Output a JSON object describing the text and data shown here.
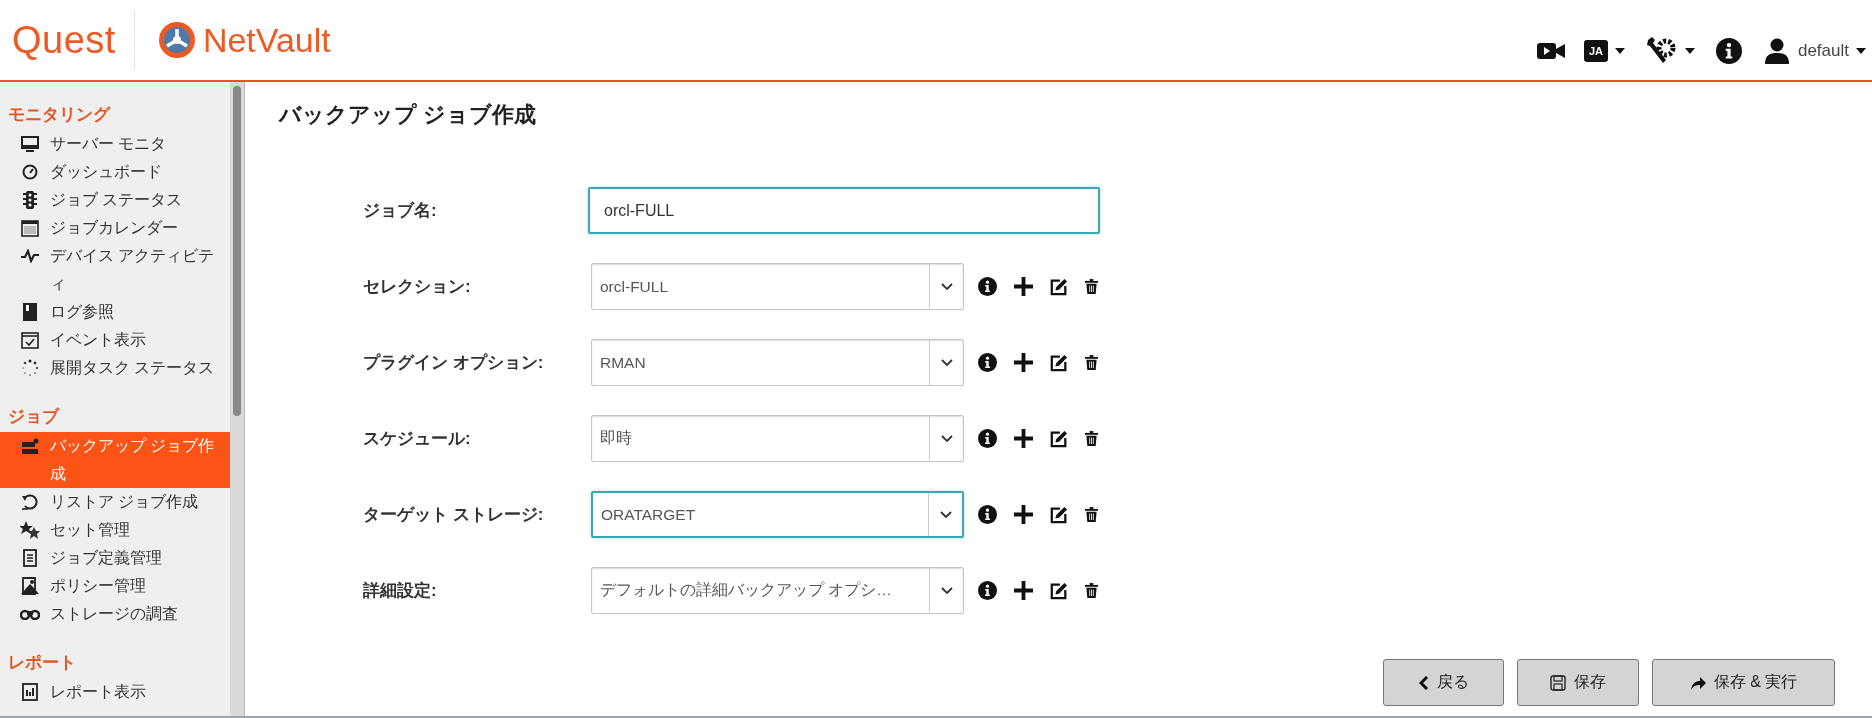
{
  "header": {
    "brand": "Quest",
    "product": "NetVault",
    "language": "JA",
    "user": "default"
  },
  "sidebar": {
    "sections": [
      {
        "title": "モニタリング",
        "items": [
          {
            "label": "サーバー モニタ",
            "selected": false
          },
          {
            "label": "ダッシュボード",
            "selected": false
          },
          {
            "label": "ジョブ ステータス",
            "selected": false
          },
          {
            "label": "ジョブカレンダー",
            "selected": false
          },
          {
            "label": "デバイス アクティビティ",
            "selected": false
          },
          {
            "label": "ログ参照",
            "selected": false
          },
          {
            "label": "イベント表示",
            "selected": false
          },
          {
            "label": "展開タスク ステータス",
            "selected": false
          }
        ]
      },
      {
        "title": "ジョブ",
        "items": [
          {
            "label": "バックアップ ジョブ作成",
            "selected": true
          },
          {
            "label": "リストア ジョブ作成",
            "selected": false
          },
          {
            "label": "セット管理",
            "selected": false
          },
          {
            "label": "ジョブ定義管理",
            "selected": false
          },
          {
            "label": "ポリシー管理",
            "selected": false
          },
          {
            "label": "ストレージの調査",
            "selected": false
          }
        ]
      },
      {
        "title": "レポート",
        "items": [
          {
            "label": "レポート表示",
            "selected": false
          }
        ]
      }
    ]
  },
  "page": {
    "title": "バックアップ ジョブ作成"
  },
  "form": {
    "fields": [
      {
        "kind": "text",
        "label": "ジョブ名:",
        "value": "orcl-FULL",
        "focused": true
      },
      {
        "kind": "select",
        "label": "セレクション:",
        "value": "orcl-FULL",
        "focused": false
      },
      {
        "kind": "select",
        "label": "プラグイン オプション:",
        "value": "RMAN",
        "focused": false
      },
      {
        "kind": "select",
        "label": "スケジュール:",
        "value": "即時",
        "focused": false
      },
      {
        "kind": "select",
        "label": "ターゲット ストレージ:",
        "value": "ORATARGET",
        "focused": true
      },
      {
        "kind": "select",
        "label": "詳細設定:",
        "value": "デフォルトの詳細バックアップ オプシ…",
        "focused": false
      }
    ]
  },
  "buttons": [
    {
      "kind": "back",
      "label": "戻る"
    },
    {
      "kind": "save",
      "label": "保存"
    },
    {
      "kind": "save-run",
      "label": "保存 & 実行"
    }
  ]
}
